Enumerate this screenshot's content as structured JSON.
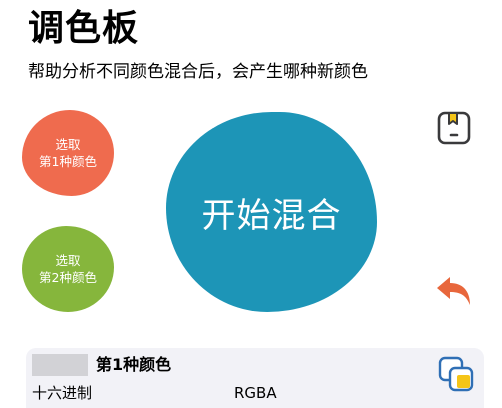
{
  "header": {
    "title": "调色板",
    "subtitle": "帮助分析不同颜色混合后，会产生哪种新颜色"
  },
  "pickers": [
    {
      "line1": "选取",
      "line2": "第1种颜色",
      "color": "#ef6b4e"
    },
    {
      "line1": "选取",
      "line2": "第2种颜色",
      "color": "#86b63c"
    }
  ],
  "mix": {
    "label": "开始混合",
    "color": "#1d95b7"
  },
  "toolbar": {
    "save_icon": "save-box-icon",
    "undo_icon": "undo-arrow-icon",
    "copy_icon": "copy-icon"
  },
  "result_card": {
    "title": "第1种颜色",
    "swatch_color": "#d2d2d6",
    "hex_label": "十六进制",
    "rgba_label": "RGBA"
  },
  "colors": {
    "accent_orange": "#e8673c",
    "icon_dark": "#3a3a3c",
    "bookmark_yellow": "#f5c518",
    "copy_blue": "#2f6fb5"
  }
}
